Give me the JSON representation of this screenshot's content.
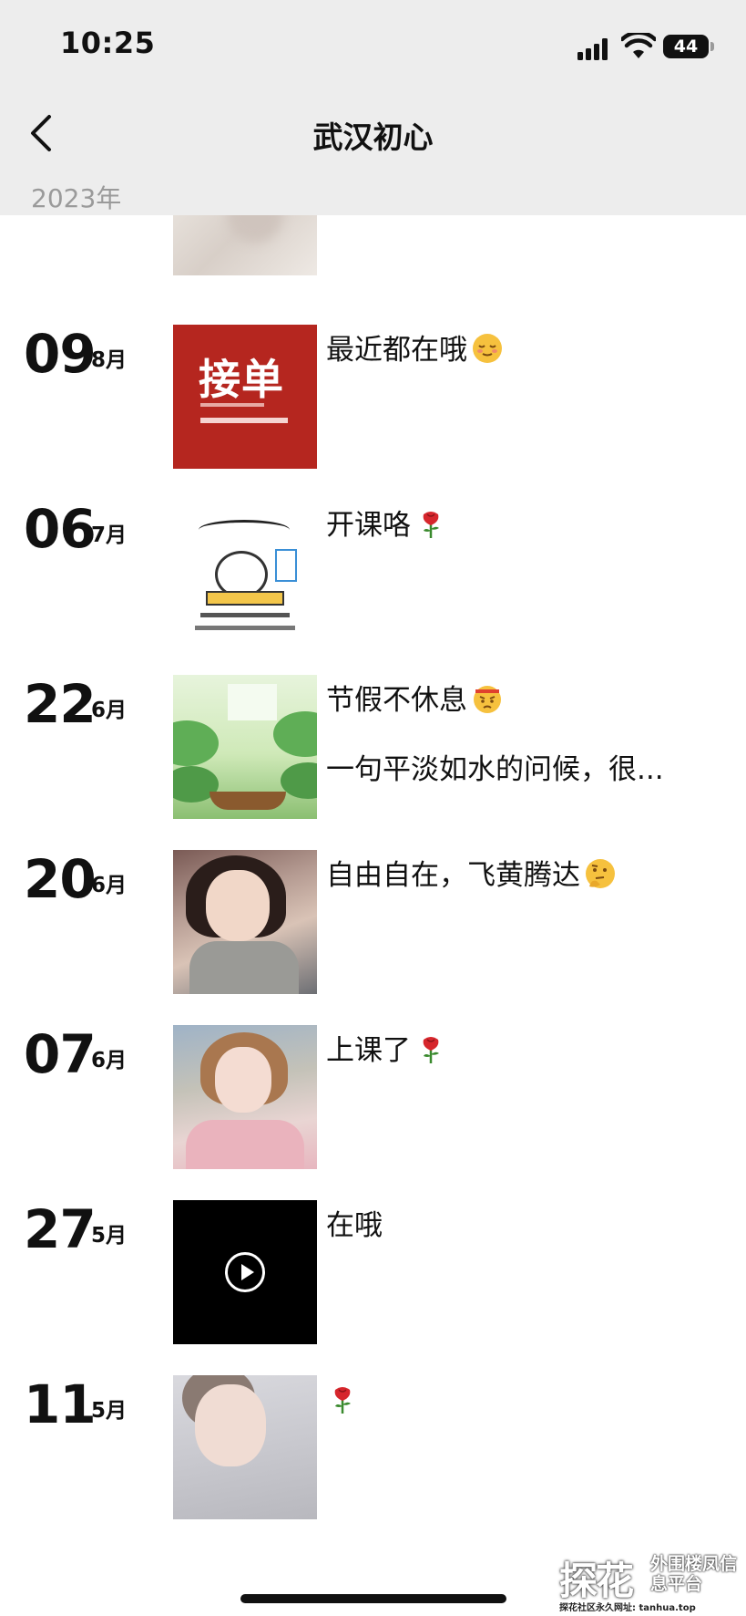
{
  "status_bar": {
    "time": "10:25",
    "battery": "44"
  },
  "nav": {
    "title": "武汉初心"
  },
  "year": "2023年",
  "entries": [
    {
      "day": "09",
      "month": "8月",
      "text": "最近都在哦",
      "emoji": "relieved-face",
      "thumb_text": "接单"
    },
    {
      "day": "06",
      "month": "7月",
      "text": "开课咯",
      "emoji": "rose"
    },
    {
      "day": "22",
      "month": "6月",
      "text": "节假不休息",
      "emoji": "angry-face",
      "text2": "一句平淡如水的问候，很..."
    },
    {
      "day": "20",
      "month": "6月",
      "text": "自由自在，飞黄腾达",
      "emoji": "thinking-face"
    },
    {
      "day": "07",
      "month": "6月",
      "text": "上课了",
      "emoji": "rose"
    },
    {
      "day": "27",
      "month": "5月",
      "text": "在哦",
      "thumb": "video"
    },
    {
      "day": "11",
      "month": "5月",
      "text": "",
      "emoji": "rose"
    }
  ],
  "watermark": {
    "logo": "探花",
    "tagline": "外围楼凤信息平台",
    "url": "探花社区永久网址: tanhua.top"
  },
  "colors": {
    "header_bg": "#ededed",
    "year_text": "#9a9a9a",
    "thumb_red": "#b5261f"
  }
}
